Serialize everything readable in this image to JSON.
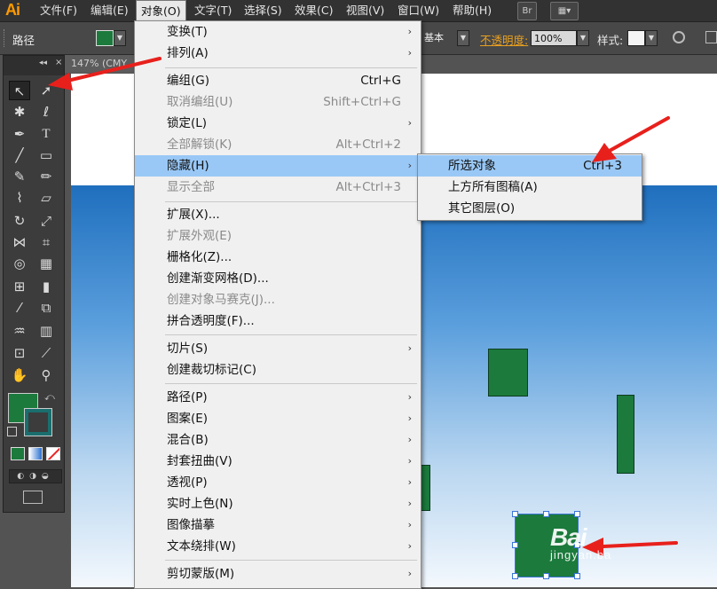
{
  "app": {
    "logo": "Ai"
  },
  "menubar": {
    "items": [
      "文件(F)",
      "编辑(E)",
      "对象(O)",
      "文字(T)",
      "选择(S)",
      "效果(C)",
      "视图(V)",
      "窗口(W)",
      "帮助(H)"
    ],
    "active_item": "对象(O)",
    "bridge_button": "Br"
  },
  "controlbar": {
    "selection_type": "路径",
    "stroke_style": "基本",
    "opacity_label": "不透明度:",
    "opacity_value": "100%",
    "style_label": "样式:"
  },
  "document": {
    "tab_title": "147% (CMY"
  },
  "object_menu": {
    "items": [
      {
        "label": "变换(T)",
        "shortcut": "",
        "submenu": true,
        "disabled": false
      },
      {
        "label": "排列(A)",
        "shortcut": "",
        "submenu": true,
        "disabled": false
      },
      {
        "label": "编组(G)",
        "shortcut": "Ctrl+G",
        "submenu": false,
        "disabled": false
      },
      {
        "label": "取消编组(U)",
        "shortcut": "Shift+Ctrl+G",
        "submenu": false,
        "disabled": true
      },
      {
        "label": "锁定(L)",
        "shortcut": "",
        "submenu": true,
        "disabled": false
      },
      {
        "label": "全部解锁(K)",
        "shortcut": "Alt+Ctrl+2",
        "submenu": false,
        "disabled": true
      },
      {
        "label": "隐藏(H)",
        "shortcut": "",
        "submenu": true,
        "disabled": false,
        "highlighted": true
      },
      {
        "label": "显示全部",
        "shortcut": "Alt+Ctrl+3",
        "submenu": false,
        "disabled": true
      },
      {
        "label": "扩展(X)...",
        "shortcut": "",
        "submenu": false,
        "disabled": false
      },
      {
        "label": "扩展外观(E)",
        "shortcut": "",
        "submenu": false,
        "disabled": true
      },
      {
        "label": "栅格化(Z)...",
        "shortcut": "",
        "submenu": false,
        "disabled": false
      },
      {
        "label": "创建渐变网格(D)...",
        "shortcut": "",
        "submenu": false,
        "disabled": false
      },
      {
        "label": "创建对象马赛克(J)...",
        "shortcut": "",
        "submenu": false,
        "disabled": true
      },
      {
        "label": "拼合透明度(F)...",
        "shortcut": "",
        "submenu": false,
        "disabled": false
      },
      {
        "label": "切片(S)",
        "shortcut": "",
        "submenu": true,
        "disabled": false
      },
      {
        "label": "创建裁切标记(C)",
        "shortcut": "",
        "submenu": false,
        "disabled": false
      },
      {
        "label": "路径(P)",
        "shortcut": "",
        "submenu": true,
        "disabled": false
      },
      {
        "label": "图案(E)",
        "shortcut": "",
        "submenu": true,
        "disabled": false
      },
      {
        "label": "混合(B)",
        "shortcut": "",
        "submenu": true,
        "disabled": false
      },
      {
        "label": "封套扭曲(V)",
        "shortcut": "",
        "submenu": true,
        "disabled": false
      },
      {
        "label": "透视(P)",
        "shortcut": "",
        "submenu": true,
        "disabled": false
      },
      {
        "label": "实时上色(N)",
        "shortcut": "",
        "submenu": true,
        "disabled": false
      },
      {
        "label": "图像描摹",
        "shortcut": "",
        "submenu": true,
        "disabled": false
      },
      {
        "label": "文本绕排(W)",
        "shortcut": "",
        "submenu": true,
        "disabled": false
      },
      {
        "label": "剪切蒙版(M)",
        "shortcut": "",
        "submenu": true,
        "disabled": false
      }
    ],
    "arrow_glyph": "›"
  },
  "hide_submenu": {
    "items": [
      {
        "label": "所选对象",
        "shortcut": "Ctrl+3",
        "highlighted": true
      },
      {
        "label": "上方所有图稿(A)",
        "shortcut": ""
      },
      {
        "label": "其它图层(O)",
        "shortcut": ""
      }
    ]
  },
  "watermark": {
    "brand": "Bai",
    "site": "jingyan.ba"
  },
  "colors": {
    "accent_fill": "#1b7a3c",
    "menu_highlight": "#99c8f6",
    "annotation_arrow": "#e8201c",
    "opacity_label": "#e8a020"
  }
}
